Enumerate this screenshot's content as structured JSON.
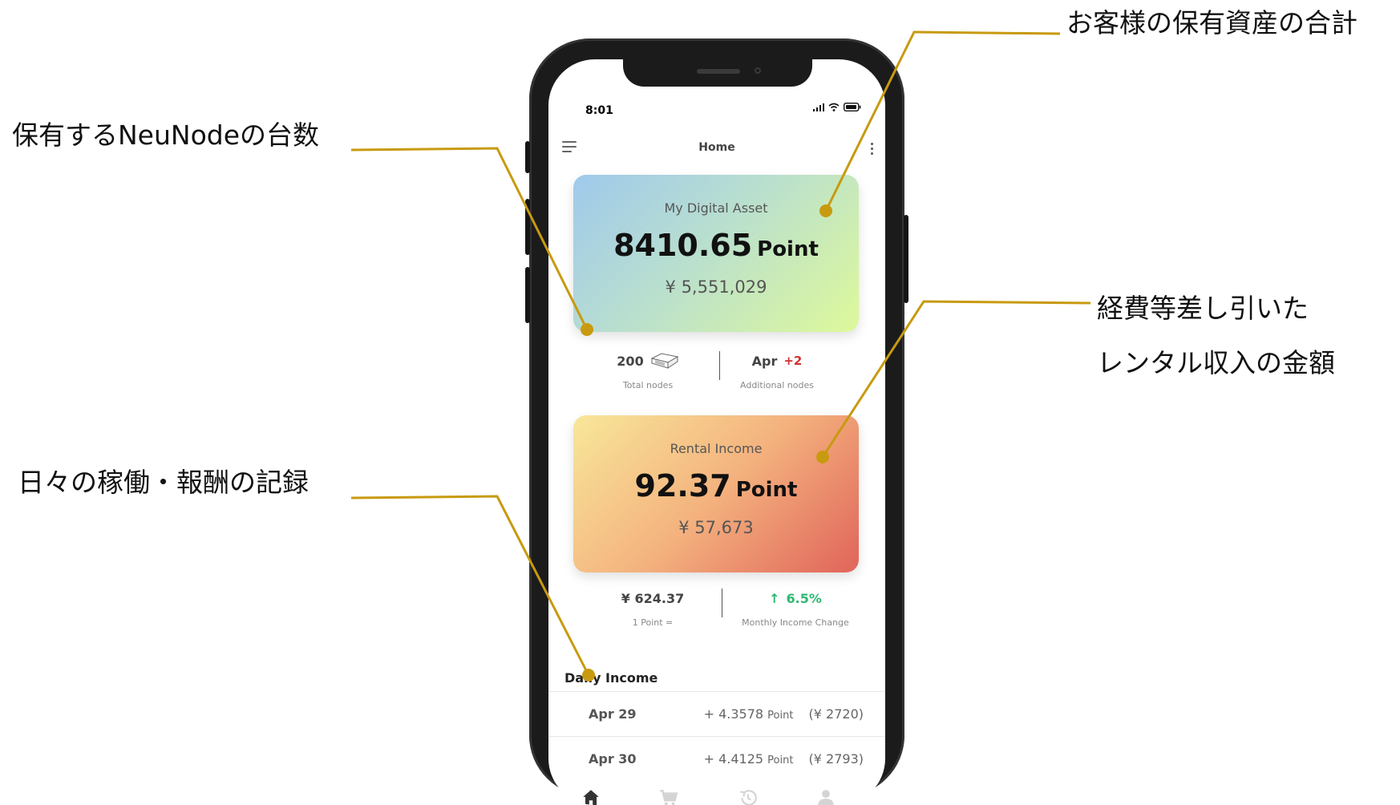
{
  "annotations": {
    "nodes": "保有するNeuNodeの台数",
    "total_assets": "お客様の保有資産の合計",
    "rental_line1": "経費等差し引いた",
    "rental_line2": "レンタル収入の金額",
    "daily": "日々の稼働・報酬の記録"
  },
  "accent_color": "#c89a10",
  "status_bar": {
    "time": "8:01"
  },
  "header": {
    "title": "Home"
  },
  "asset_card": {
    "label": "My Digital Asset",
    "value": "8410.65",
    "unit": "Point",
    "yen": "¥ 5,551,029"
  },
  "node_stats": {
    "total_value": "200",
    "total_label": "Total nodes",
    "month": "Apr",
    "added": "+2",
    "added_label": "Additional nodes"
  },
  "rental_card": {
    "label": "Rental Income",
    "value": "92.37",
    "unit": "Point",
    "yen": "¥ 57,673"
  },
  "rate_stats": {
    "rate_value": "¥ 624.37",
    "rate_label": "1 Point =",
    "change_value": "6.5%",
    "change_label": "Monthly Income Change"
  },
  "daily_income": {
    "title": "Daily Income",
    "rows": [
      {
        "date": "Apr 29",
        "points": "+ 4.3578",
        "unit": "Point",
        "yen": "(¥ 2720)"
      },
      {
        "date": "Apr 30",
        "points": "+ 4.4125",
        "unit": "Point",
        "yen": "(¥ 2793)"
      }
    ]
  },
  "tabs": [
    "home-icon",
    "cart-icon",
    "history-icon",
    "profile-icon"
  ]
}
